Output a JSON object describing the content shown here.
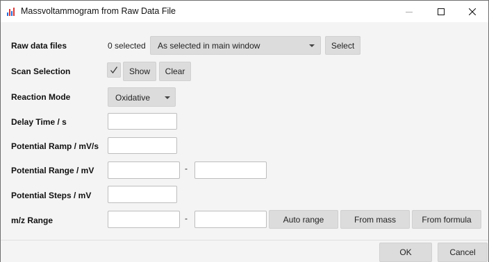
{
  "window": {
    "title": "Massvoltammogram from Raw Data File"
  },
  "rows": {
    "raw_data_files": {
      "label": "Raw data files",
      "selected_count": "0 selected",
      "combo_value": "As selected in main window",
      "select_button": "Select"
    },
    "scan_selection": {
      "label": "Scan Selection",
      "checked": true,
      "show_button": "Show",
      "clear_button": "Clear"
    },
    "reaction_mode": {
      "label": "Reaction Mode",
      "value": "Oxidative"
    },
    "delay_time": {
      "label": "Delay Time / s",
      "value": ""
    },
    "potential_ramp": {
      "label": "Potential Ramp / mV/s",
      "value": ""
    },
    "potential_range": {
      "label": "Potential Range / mV",
      "min": "",
      "separator": "-",
      "max": ""
    },
    "potential_steps": {
      "label": "Potential Steps / mV",
      "value": ""
    },
    "mz_range": {
      "label": "m/z Range",
      "min": "",
      "separator": "-",
      "max": "",
      "auto_range_button": "Auto range",
      "from_mass_button": "From mass",
      "from_formula_button": "From formula"
    }
  },
  "footer": {
    "ok_button": "OK",
    "cancel_button": "Cancel"
  },
  "icons": {
    "app": "chart-bars-icon",
    "minimize": "minimize-icon",
    "maximize": "maximize-icon",
    "close": "close-icon",
    "check": "checkmark-icon"
  },
  "colors": {
    "button_bg": "#dcdcdc",
    "client_bg": "#f4f4f4",
    "titlebar_bg": "#ffffff",
    "field_border": "#bdbdbd"
  }
}
